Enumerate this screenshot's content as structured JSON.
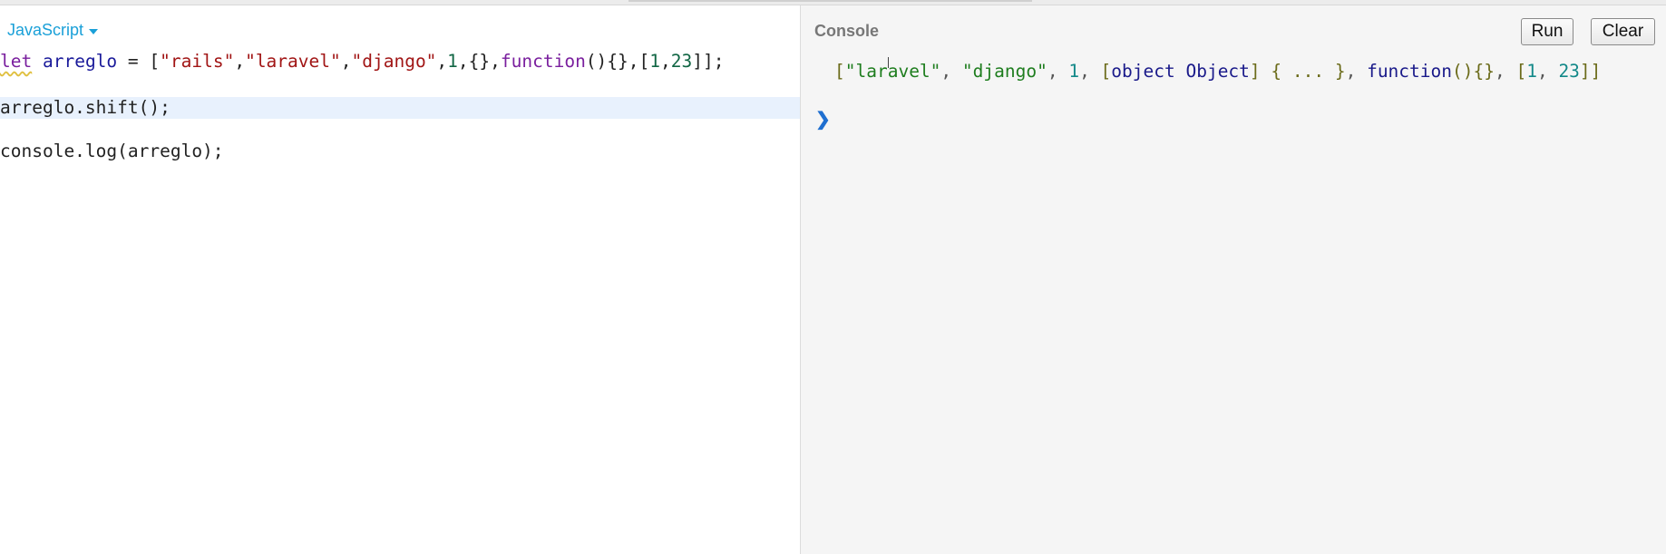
{
  "editor": {
    "language": "JavaScript",
    "lines": {
      "l1": {
        "t_let": "let",
        "t_sp1": " ",
        "t_var": "arreglo",
        "t_eq": " = [",
        "t_s1": "\"rails\"",
        "t_c1": ",",
        "t_s2": "\"laravel\"",
        "t_c2": ",",
        "t_s3": "\"django\"",
        "t_c3": ",",
        "t_n1": "1",
        "t_obj": ",{},",
        "t_fn": "function",
        "t_fnb": "(){},[",
        "t_n2": "1",
        "t_c4": ",",
        "t_n3": "23",
        "t_end": "]];"
      },
      "l2": "arreglo.shift();",
      "l3": "console.log(arreglo);"
    }
  },
  "console": {
    "title": "Console",
    "run_label": "Run",
    "clear_label": "Clear",
    "output": {
      "o_open": "[",
      "o_s1": "\"laravel\"",
      "o_c1": ", ",
      "o_s2": "\"django\"",
      "o_c2": ", ",
      "o_n1": "1",
      "o_c3": ", ",
      "o_obj_open": "[",
      "o_obj": "object Object",
      "o_obj_close": "]",
      "o_obj_body": " { ... }",
      "o_c4": ", ",
      "o_fn": "function",
      "o_fnb": "(){}",
      "o_c5": ", ",
      "o_arr_open": "[",
      "o_n2": "1",
      "o_c6": ", ",
      "o_n3": "23",
      "o_arr_close": "]",
      "o_close": "]"
    },
    "prompt": "❯"
  }
}
